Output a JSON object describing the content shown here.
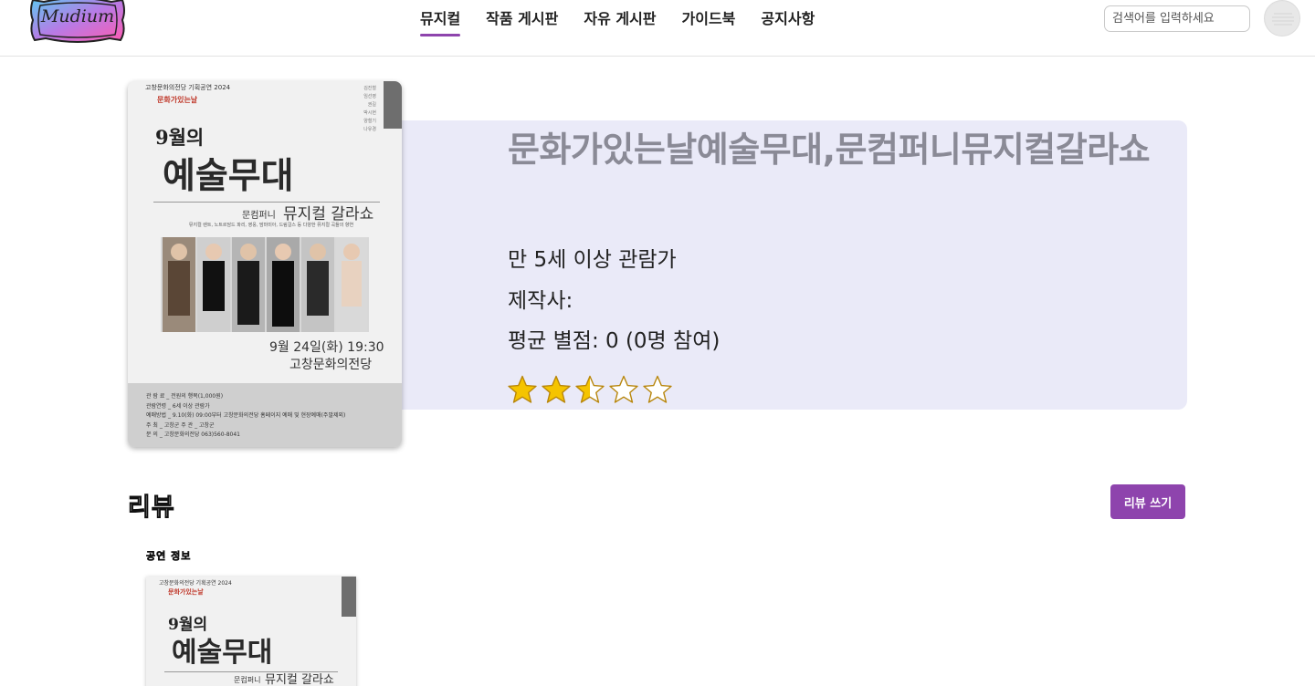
{
  "header": {
    "logo_text": "Mudium",
    "nav": [
      {
        "label": "뮤지컬",
        "active": true
      },
      {
        "label": "작품 게시판",
        "active": false
      },
      {
        "label": "자유 게시판",
        "active": false
      },
      {
        "label": "가이드북",
        "active": false
      },
      {
        "label": "공지사항",
        "active": false
      }
    ],
    "search_placeholder": "검색어를 입력하세요"
  },
  "show": {
    "title": "문화가있는날예술무대,문컴퍼니뮤지컬갈라쇼",
    "age_rating": "만 5세 이상 관람가",
    "producer": "제작사:",
    "avg_rating": "평균 별점: 0 (0명 참여)",
    "stars": [
      "full",
      "full",
      "half",
      "empty",
      "empty"
    ],
    "star_color": "#f5c400"
  },
  "poster": {
    "organizer": "고창문화의전당 기획공연 2024",
    "brand": "문화가있는날",
    "month": "9월의",
    "headline": "예술무대",
    "company": "문컴퍼니",
    "subtitle": "뮤지컬 갈라쇼",
    "tagline": "뮤지컬 렌트, 노트르담드 파리, 영웅, 맘마미아, 드림걸스 등 다양한 뮤지컬 곡들의 향연",
    "cast": [
      "김진철",
      "임선영",
      "권길",
      "박시현",
      "양철기",
      "나유경"
    ],
    "date": "9월 24일(화) 19:30",
    "venue": "고창문화의전당",
    "details": [
      "관 람 료 _ 전원의 행복(1,000원)",
      "관람연령 _ 6세 이상 관람가",
      "예매방법 _ 9.10(화) 09:00부터 고창문화의전당 홈페이지 예매 및 현장예매(주말제외)",
      "주    최 _ 고창군      주    관 _ 고창군",
      "문    의 _ 고창문화의전당 063)560-8041"
    ]
  },
  "reviews": {
    "heading": "리뷰",
    "write_button": "리뷰 쓰기",
    "show_info_label": "공연 정보"
  }
}
